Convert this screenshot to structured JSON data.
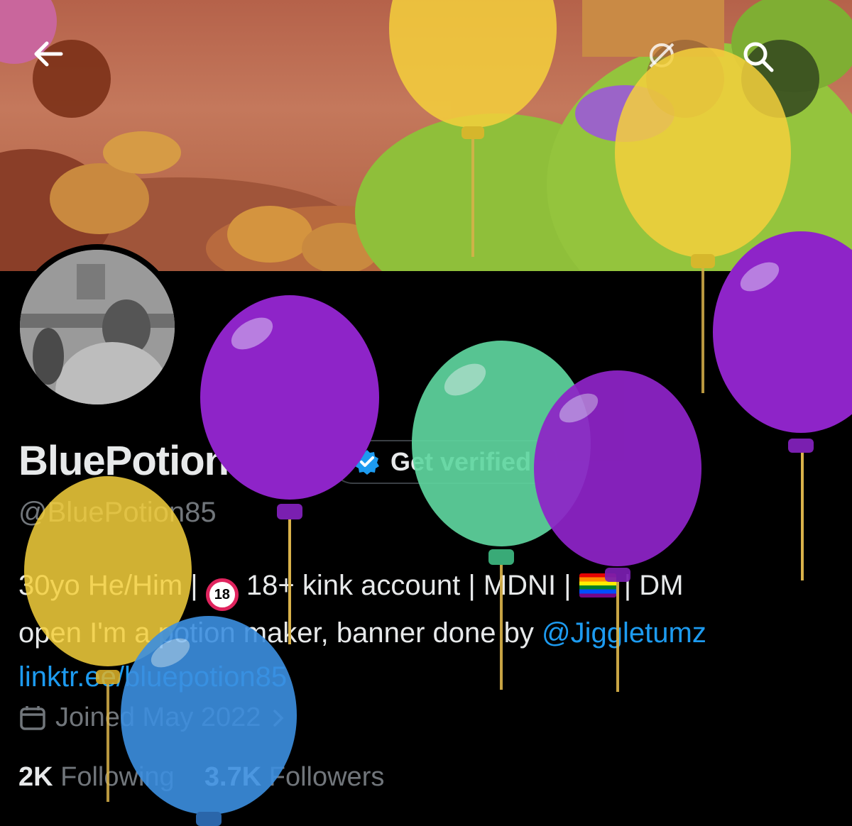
{
  "header": {
    "back_icon": "arrow-left-icon",
    "grok_icon": "grok-icon",
    "search_icon": "search-icon"
  },
  "profile": {
    "display_name": "BluePotion85",
    "verify_label": "Get verified",
    "handle": "@BluePotion85",
    "bio_line1_a": "30yo He/Him | ",
    "bio_line1_b": " 18+ kink account | MDNI | ",
    "bio_line1_c": " | DM",
    "bio_line2_a": "open I'm a potion maker, banner done by ",
    "bio_mention": "@Jiggletumz",
    "bio_link": "linktr.ee/bluepotion85",
    "joined": "Joined May 2022",
    "following_count": "2K",
    "following_label": "Following",
    "followers_count": "3.7K",
    "followers_label": "Followers"
  },
  "colors": {
    "accent": "#1d9bf0",
    "balloon_yellow": "#f5d03c",
    "balloon_purple": "#8e24c8",
    "balloon_green": "#5fd6a0",
    "balloon_blue": "#3c8fe0"
  }
}
